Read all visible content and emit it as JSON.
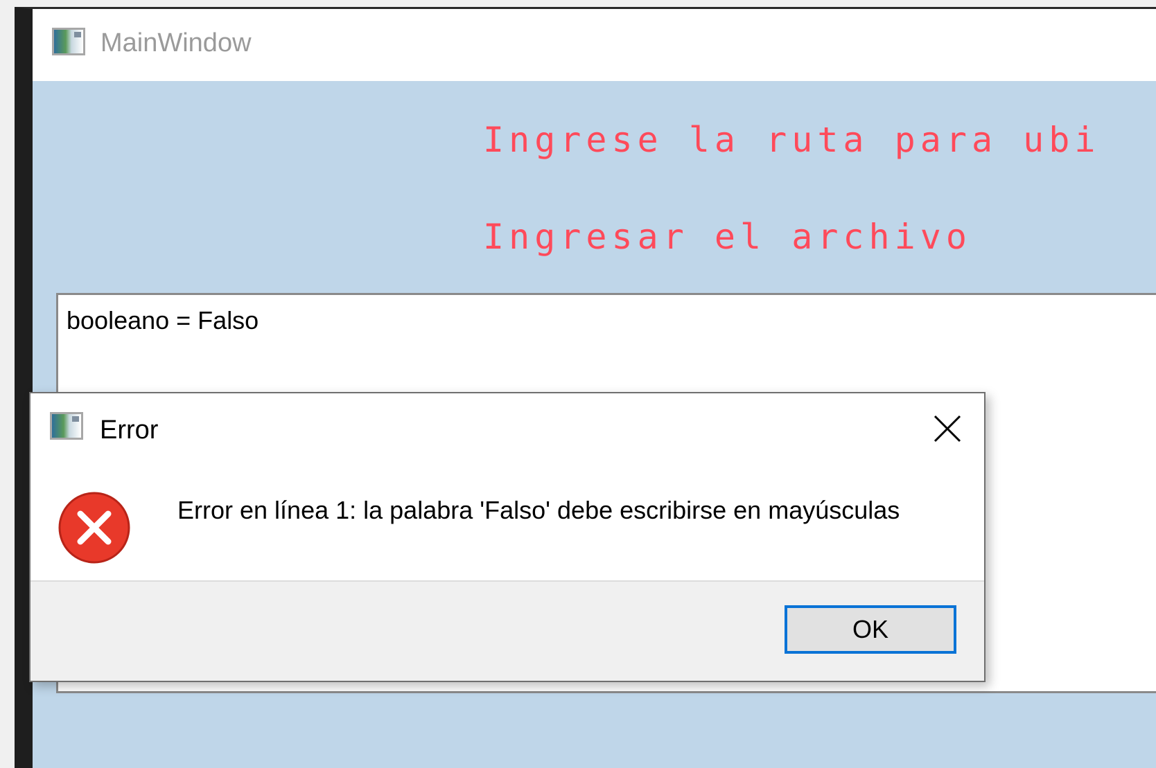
{
  "main_window": {
    "title": "MainWindow",
    "icon": "window-app-icon",
    "instruction_line_1": "Ingrese la ruta para ubi",
    "instruction_line_2": "Ingresar el archivo",
    "instruction_color": "#ff4a5a",
    "background_color": "#bfd6e9",
    "editor": {
      "content": "booleano = Falso"
    }
  },
  "error_dialog": {
    "title": "Error",
    "icon": "window-app-icon",
    "message_icon": "error-icon",
    "message": "Error en línea 1: la palabra 'Falso' debe escribirse en mayúsculas",
    "close_icon": "close-icon",
    "ok_label": "OK",
    "accent_color": "#0a73d6"
  }
}
